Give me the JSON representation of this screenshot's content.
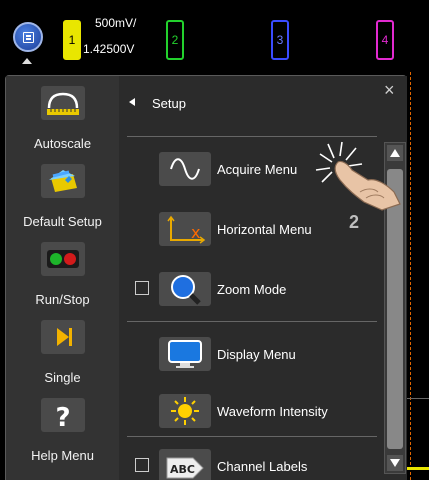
{
  "channels": {
    "ch1": {
      "number": "1",
      "scale": "500mV/",
      "offset": "1.42500V",
      "color": "#e9e600"
    },
    "ch2": {
      "number": "2",
      "color": "#23d12d"
    },
    "ch3": {
      "number": "3",
      "color": "#3a4cff"
    },
    "ch4": {
      "number": "4",
      "color": "#e22ad0"
    }
  },
  "sidebar": {
    "items": [
      {
        "label": "Autoscale",
        "icon": "autoscale-icon"
      },
      {
        "label": "Default Setup",
        "icon": "default-setup-icon"
      },
      {
        "label": "Run/Stop",
        "icon": "run-stop-icon"
      },
      {
        "label": "Single",
        "icon": "single-icon"
      },
      {
        "label": "Help Menu",
        "icon": "help-icon"
      }
    ]
  },
  "menu": {
    "title": "Setup",
    "close": "×",
    "items": [
      {
        "label": "Acquire Menu",
        "icon": "sine-wave-icon",
        "has_checkbox": false
      },
      {
        "label": "Horizontal Menu",
        "icon": "horizontal-axis-icon",
        "has_checkbox": false
      },
      {
        "label": "Zoom Mode",
        "icon": "magnifier-icon",
        "has_checkbox": true,
        "checked": false
      },
      {
        "label": "Display Menu",
        "icon": "monitor-icon",
        "has_checkbox": false
      },
      {
        "label": "Waveform Intensity",
        "icon": "sun-icon",
        "has_checkbox": false
      },
      {
        "label": "Channel Labels",
        "icon": "abc-label-icon",
        "has_checkbox": true,
        "checked": false
      }
    ]
  },
  "callout": {
    "step": "2"
  }
}
